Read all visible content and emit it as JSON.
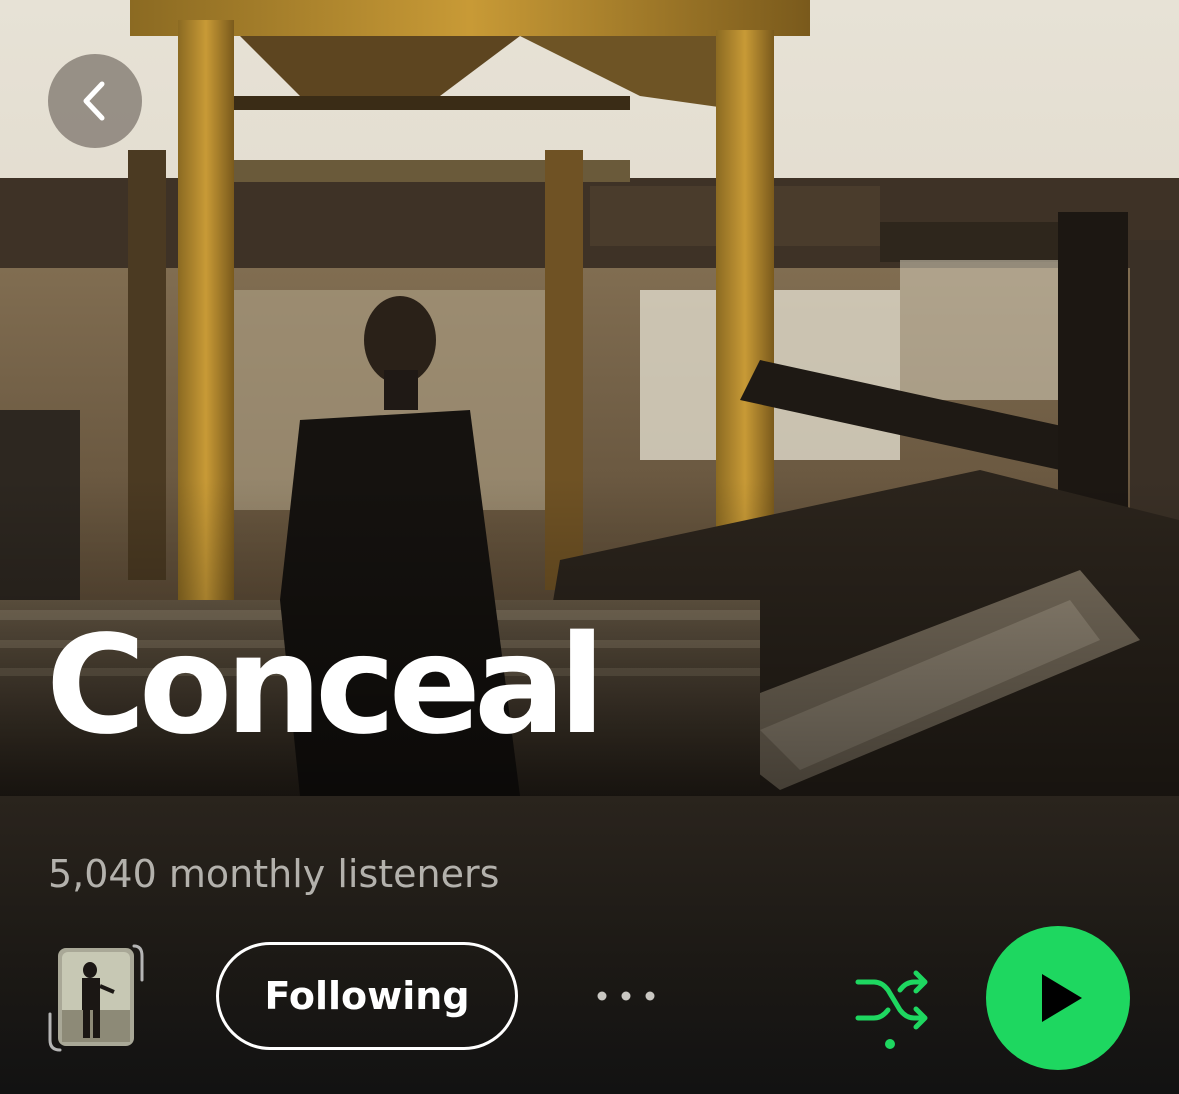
{
  "artist": {
    "name": "Conceal",
    "monthly_listeners": "5,040 monthly listeners"
  },
  "actions": {
    "follow_label": "Following",
    "more_icon": "more-horizontal-icon",
    "shuffle_icon": "shuffle-icon",
    "play_icon": "play-icon",
    "back_icon": "chevron-left-icon"
  },
  "colors": {
    "accent": "#1ed760",
    "background": "#121212",
    "text_primary": "#ffffff",
    "text_secondary": "#b3b1ac"
  }
}
